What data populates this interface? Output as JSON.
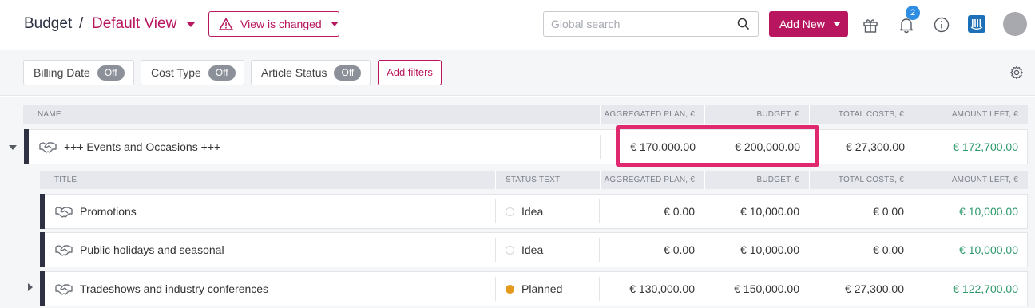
{
  "header": {
    "breadcrumb_root": "Budget",
    "breadcrumb_sep": "/",
    "current_view": "Default View",
    "view_changed_label": "View is changed",
    "search_placeholder": "Global search",
    "add_new_label": "Add New",
    "notification_count": "2",
    "icons": [
      "gift-icon",
      "bell-icon",
      "info-icon",
      "app-icon"
    ]
  },
  "filters": [
    {
      "label": "Billing Date",
      "state": "Off"
    },
    {
      "label": "Cost Type",
      "state": "Off"
    },
    {
      "label": "Article Status",
      "state": "Off"
    }
  ],
  "add_filters_label": "Add filters",
  "table": {
    "columns": [
      "NAME",
      "AGGREGATED PLAN, €",
      "BUDGET, €",
      "TOTAL COSTS, €",
      "AMOUNT LEFT, €"
    ],
    "group": {
      "name": "+++ Events and Occasions +++",
      "aggregated_plan": "€ 170,000.00",
      "budget": "€ 200,000.00",
      "total_costs": "€ 27,300.00",
      "amount_left": "€ 172,700.00"
    },
    "sub_columns": [
      "TITLE",
      "STATUS TEXT",
      "AGGREGATED PLAN, €",
      "BUDGET, €",
      "TOTAL COSTS, €",
      "AMOUNT LEFT, €"
    ],
    "rows": [
      {
        "title": "Promotions",
        "status": "Idea",
        "aggregated_plan": "€ 0.00",
        "budget": "€ 10,000.00",
        "total_costs": "€ 0.00",
        "amount_left": "€ 10,000.00"
      },
      {
        "title": "Public holidays and seasonal",
        "status": "Idea",
        "aggregated_plan": "€ 0.00",
        "budget": "€ 10,000.00",
        "total_costs": "€ 0.00",
        "amount_left": "€ 10,000.00"
      },
      {
        "title": "Tradeshows and industry conferences",
        "status": "Planned",
        "aggregated_plan": "€ 130,000.00",
        "budget": "€ 150,000.00",
        "total_costs": "€ 27,300.00",
        "amount_left": "€ 122,700.00"
      }
    ]
  },
  "colors": {
    "accent": "#b8165e",
    "positive": "#2e9a6a",
    "planned": "#e49a1c",
    "highlight": "#e0286e"
  }
}
